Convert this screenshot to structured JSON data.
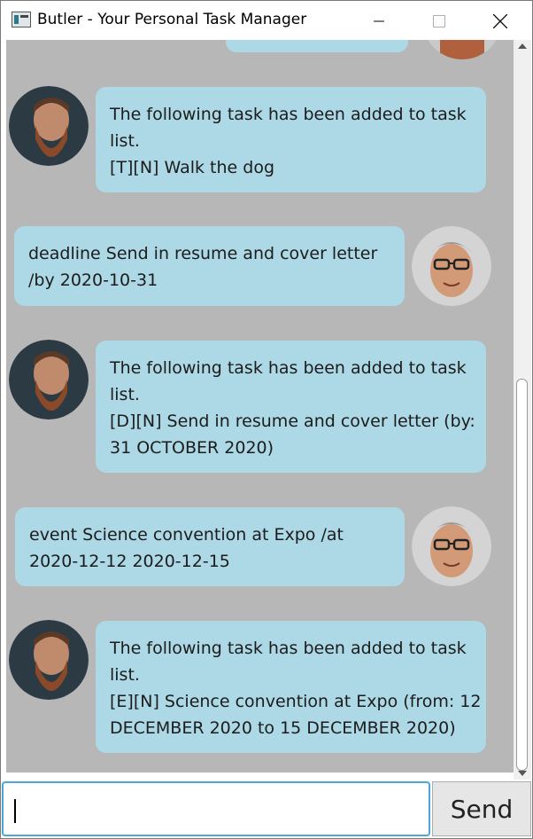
{
  "window": {
    "title": "Butler - Your Personal Task Manager"
  },
  "messages": [
    {
      "sender": "butler",
      "lines": [
        "The following task has been added to task",
        "list.",
        "[T][N] Walk the dog"
      ]
    },
    {
      "sender": "user",
      "lines": [
        "deadline Send in resume and cover letter",
        "/by 2020-10-31"
      ]
    },
    {
      "sender": "butler",
      "lines": [
        "The following task has been added to task",
        "list.",
        "[D][N] Send in resume and cover letter (by:",
        "31 OCTOBER 2020)"
      ]
    },
    {
      "sender": "user",
      "lines": [
        "event Science convention at Expo /at",
        "2020-12-12 2020-12-15"
      ]
    },
    {
      "sender": "butler",
      "lines": [
        "The following task has been added to task",
        "list.",
        "[E][N] Science convention at Expo (from: 12",
        "DECEMBER 2020 to 15 DECEMBER 2020)"
      ]
    }
  ],
  "input": {
    "value": "",
    "send_label": "Send"
  },
  "colors": {
    "bubble": "#add8e6",
    "chat_background": "#b7b7b7",
    "input_focus": "#4aa7d8"
  }
}
